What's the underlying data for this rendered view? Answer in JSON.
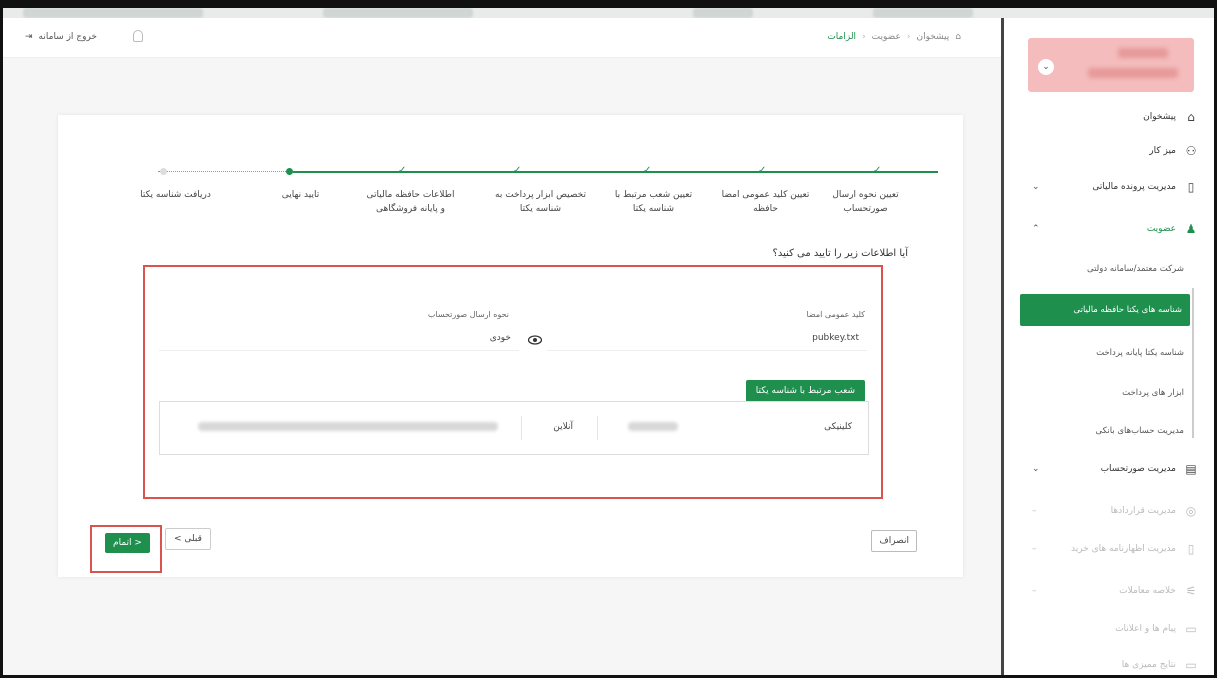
{
  "header": {
    "logout_label": "خروج از سامانه",
    "breadcrumb": [
      "پیشخوان",
      "عضویت",
      "الزامات"
    ]
  },
  "stepper": {
    "steps": [
      {
        "label": "تعیین نحوه ارسال صورتحساب",
        "status": "done"
      },
      {
        "label": "تعیین کلید عمومی امضا حافظه",
        "status": "done"
      },
      {
        "label": "تعیین شعب مرتبط با شناسه یکتا",
        "status": "done"
      },
      {
        "label": "تخصیص ابزار پرداخت به شناسه یکتا",
        "status": "done"
      },
      {
        "label": "اطلاعات حافظه مالیاتی و پایانه فروشگاهی",
        "status": "done"
      },
      {
        "label": "تایید نهایی",
        "status": "current"
      },
      {
        "label": "دریافت شناسه یکتا",
        "status": "pending"
      }
    ]
  },
  "confirm": {
    "question": "آیا اطلاعات زیر را تایید می کنید؟",
    "public_key_label": "کلید عمومی امضا",
    "public_key_value": "pubkey.txt",
    "send_method_label": "نحوه ارسال صورتحساب",
    "send_method_value": "خودی",
    "branches_button": "شعب مرتبط با شناسه یکتا",
    "branch_row": {
      "name": "کلینیکی",
      "type": "آنلاین"
    }
  },
  "buttons": {
    "cancel": "انصراف",
    "previous": "قبلی >",
    "finish": "< اتمام"
  },
  "sidebar": {
    "items": [
      {
        "label": "پیشخوان",
        "icon": "home-icon"
      },
      {
        "label": "میز کار",
        "icon": "workspace-icon"
      },
      {
        "label": "مدیریت پرونده مالیاتی",
        "icon": "file-icon"
      },
      {
        "label": "عضویت",
        "icon": "user-icon"
      }
    ],
    "sub_items": [
      "شرکت معتمد/سامانه دولتی",
      "شناسه های یکتا حافظه مالیاتی",
      "شناسه یکتا پایانه پرداخت",
      "ابزار های پرداخت",
      "مدیریت حساب‌های بانکی"
    ],
    "more_items": [
      "مدیریت صورتحساب",
      "مدیریت قراردادها",
      "مدیریت اظهارنامه های خرید",
      "خلاصه معاملات",
      "پیام ها و اعلانات",
      "نتایج ممیزی ها"
    ],
    "accent_color": "#1f8f4e"
  }
}
